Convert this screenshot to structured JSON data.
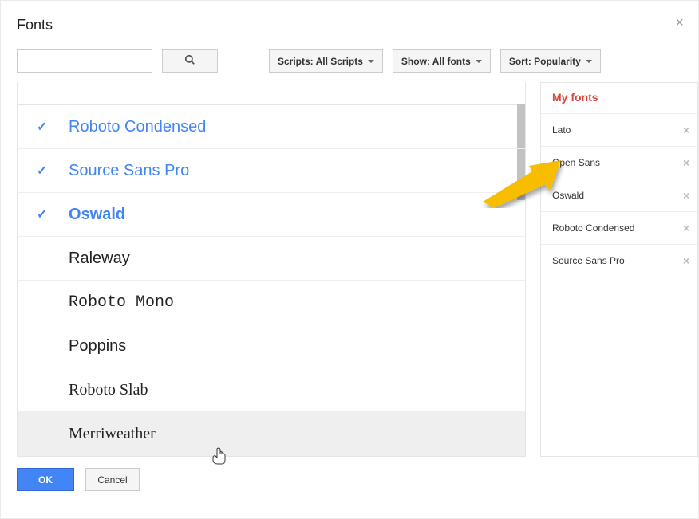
{
  "dialog": {
    "title": "Fonts",
    "close_glyph": "×"
  },
  "toolbar": {
    "scripts_label": "Scripts: All Scripts",
    "show_label": "Show: All fonts",
    "sort_label": "Sort: Popularity"
  },
  "fonts": [
    {
      "name": "Roboto Condensed",
      "selected": true,
      "css": "font-roboto-condensed",
      "hover": false
    },
    {
      "name": "Source Sans Pro",
      "selected": true,
      "css": "font-source-sans",
      "hover": false
    },
    {
      "name": "Oswald",
      "selected": true,
      "css": "font-oswald",
      "hover": false
    },
    {
      "name": "Raleway",
      "selected": false,
      "css": "font-raleway",
      "hover": false
    },
    {
      "name": "Roboto Mono",
      "selected": false,
      "css": "font-roboto-mono",
      "hover": false
    },
    {
      "name": "Poppins",
      "selected": false,
      "css": "font-poppins",
      "hover": false
    },
    {
      "name": "Roboto Slab",
      "selected": false,
      "css": "font-roboto-slab",
      "hover": false
    },
    {
      "name": "Merriweather",
      "selected": false,
      "css": "font-merriweather",
      "hover": true
    }
  ],
  "my_fonts": {
    "title": "My fonts",
    "items": [
      {
        "name": "Lato"
      },
      {
        "name": "Open Sans"
      },
      {
        "name": "Oswald"
      },
      {
        "name": "Roboto Condensed"
      },
      {
        "name": "Source Sans Pro"
      }
    ],
    "remove_glyph": "×"
  },
  "footer": {
    "ok": "OK",
    "cancel": "Cancel"
  }
}
